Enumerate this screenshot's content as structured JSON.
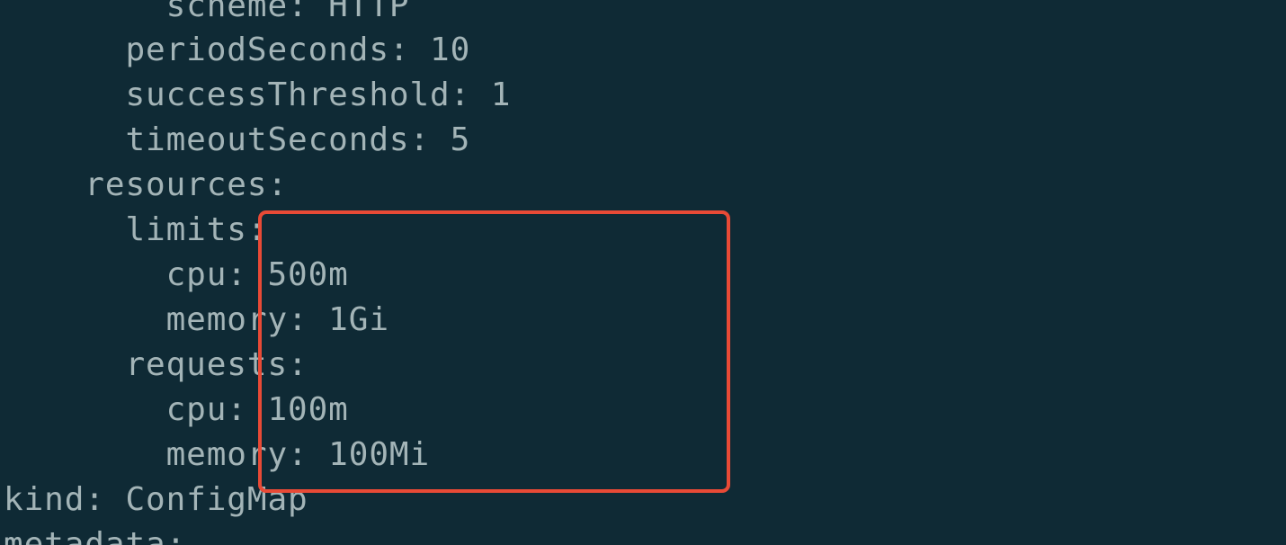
{
  "terminal": {
    "lines": [
      "        scheme: HTTP",
      "      periodSeconds: 10",
      "      successThreshold: 1",
      "      timeoutSeconds: 5",
      "    resources:",
      "      limits:",
      "        cpu: 500m",
      "        memory: 1Gi",
      "      requests:",
      "        cpu: 100m",
      "        memory: 100Mi",
      "",
      "kind: ConfigMap",
      "metadata:"
    ]
  },
  "highlight": {
    "color": "#e84a36"
  },
  "colors": {
    "background": "#0f2a35",
    "text": "#a3b4b7"
  }
}
